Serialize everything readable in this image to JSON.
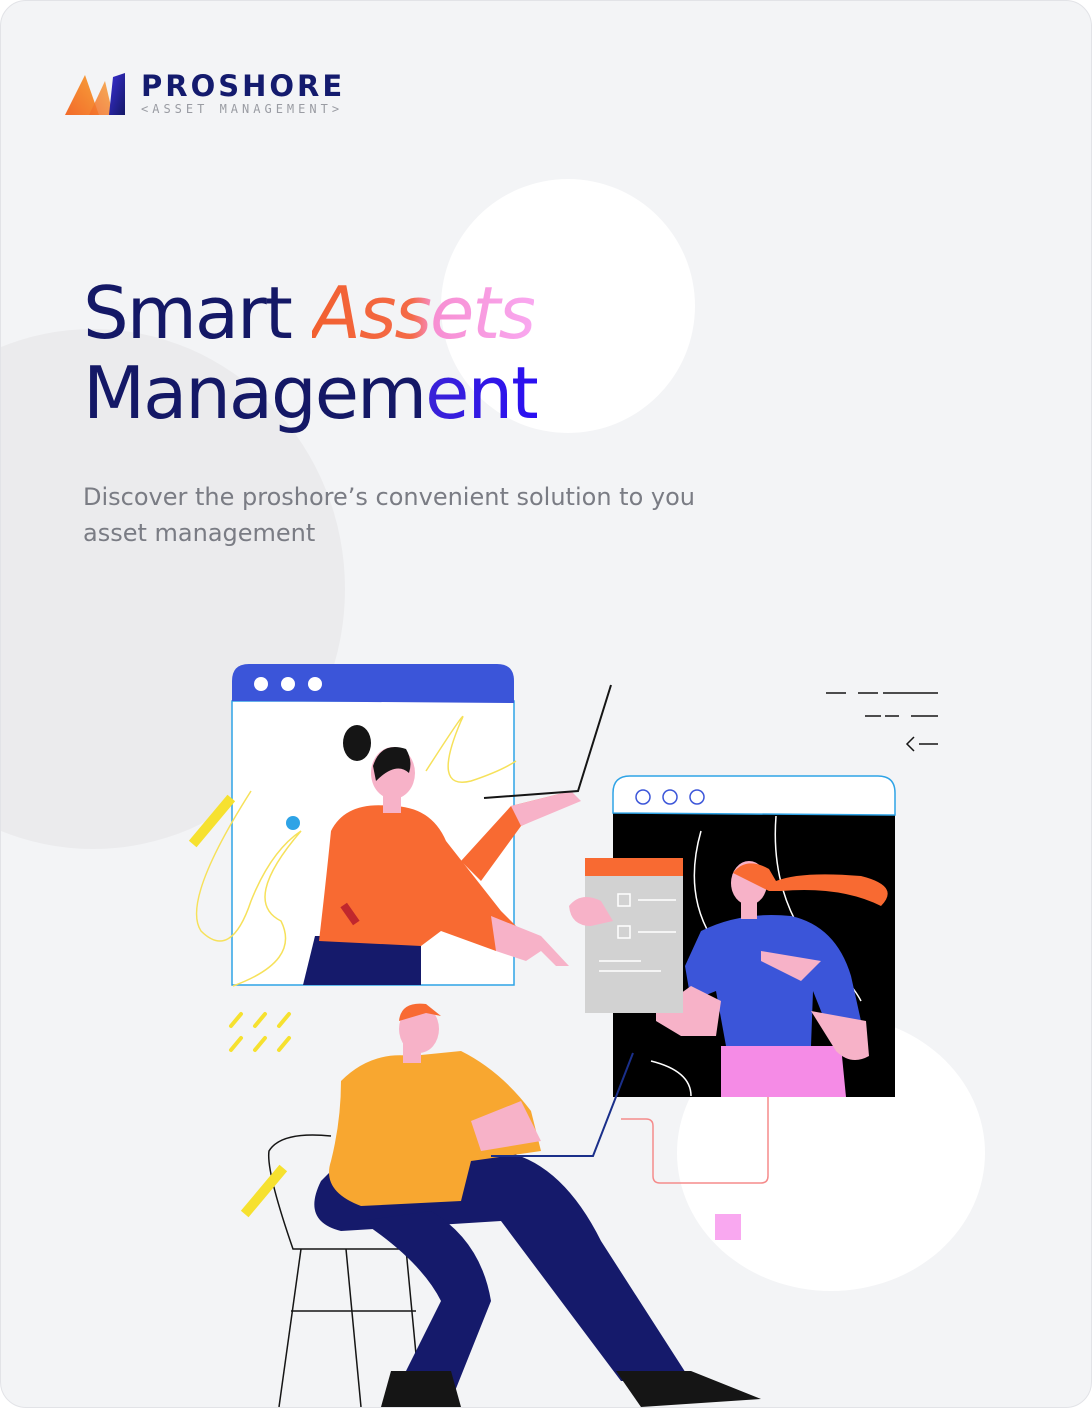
{
  "brand": {
    "name": "PROSHORE",
    "tagline": "<ASSET MANAGEMENT>"
  },
  "hero": {
    "headline_word_1": "Smart ",
    "headline_word_2": "Assets",
    "headline_line_2_start": "Managem",
    "headline_line_2_end": "ent",
    "subtitle": "Discover the proshore’s convenient solution to you asset management"
  },
  "colors": {
    "navy": "#141866",
    "orange": "#f2602f",
    "pink": "#f9a8f0",
    "blue": "#3b55d9",
    "background": "#f3f4f6"
  },
  "illustration": {
    "name": "people-collaborating-remote-video-call-illustration"
  }
}
